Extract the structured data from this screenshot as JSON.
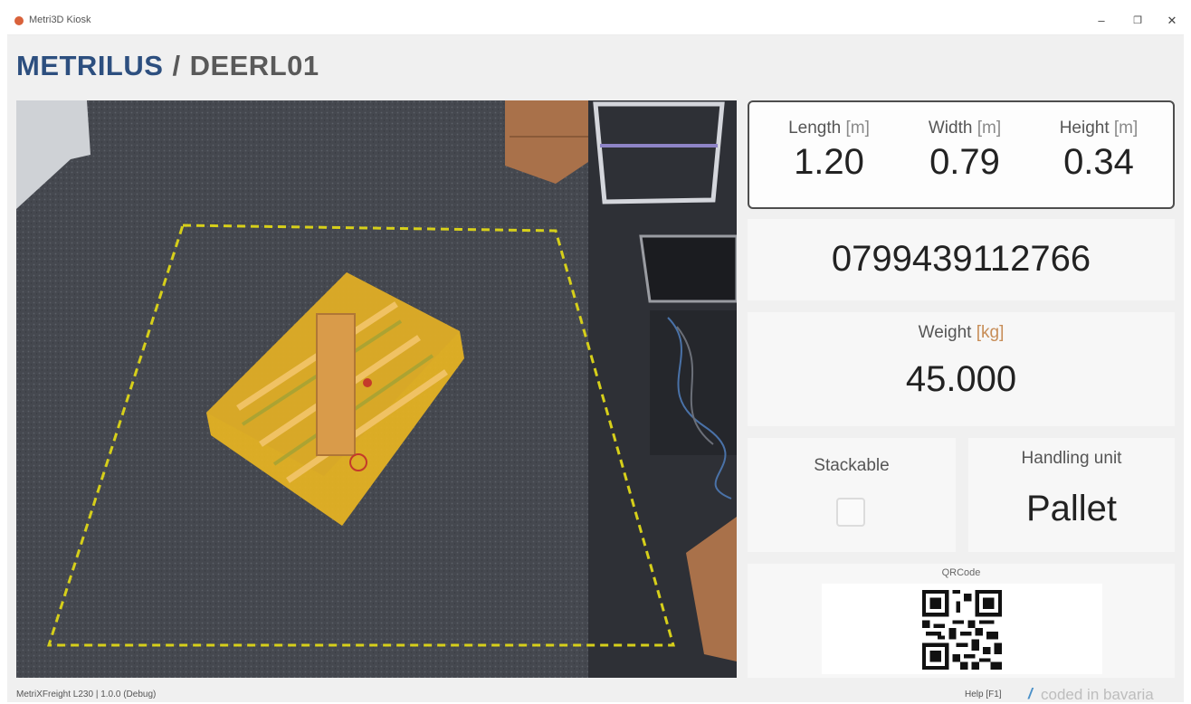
{
  "window": {
    "title": "Metri3D Kiosk",
    "minimize": "–",
    "maximize": "❐",
    "close": "✕"
  },
  "header": {
    "brand": "METRILUS",
    "separator": "/",
    "station": "DEERL01"
  },
  "dimensions": {
    "length": {
      "label": "Length",
      "unit": "[m]",
      "value": "1.20"
    },
    "width": {
      "label": "Width",
      "unit": "[m]",
      "value": "0.79"
    },
    "height": {
      "label": "Height",
      "unit": "[m]",
      "value": "0.34"
    }
  },
  "barcode": "0799439112766",
  "weight": {
    "label": "Weight",
    "unit": "[kg]",
    "value": "45.000"
  },
  "stackable": {
    "label": "Stackable",
    "checked": false
  },
  "handling_unit": {
    "label": "Handling unit",
    "value": "Pallet"
  },
  "qr": {
    "label": "QRCode"
  },
  "status": {
    "left": "MetriXFreight L230 | 1.0.0 (Debug)",
    "help": "Help [F1]",
    "coded": "coded in bavaria"
  },
  "colors": {
    "brand": "#2d4f7f",
    "header_gray": "#5a5a5a",
    "measurement_zone": "#d6cf1a",
    "pallet_overlay": "#e6b422",
    "coded_slash": "#4a90c8"
  }
}
